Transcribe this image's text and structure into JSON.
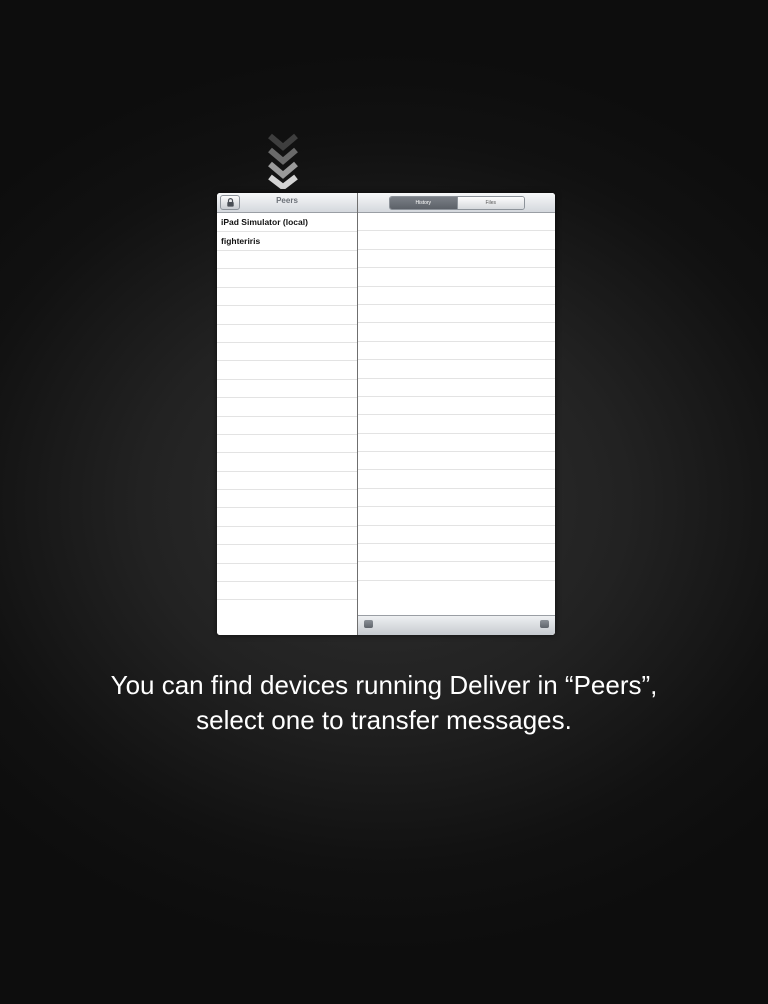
{
  "left_pane": {
    "title": "Peers",
    "lock_icon": "lock-icon",
    "peers": [
      "iPad Simulator (local)",
      "fighteriris"
    ]
  },
  "right_pane": {
    "tabs": [
      {
        "label": "History",
        "selected": true
      },
      {
        "label": "Files",
        "selected": false
      }
    ],
    "toolbar_icons": [
      "list-icon",
      "add-icon"
    ]
  },
  "caption": {
    "line1": "You can find devices running Deliver in “Peers”,",
    "line2": "select one to transfer messages."
  },
  "colors": {
    "background": "#1c1c1c",
    "caption_text": "#ffffff",
    "segment_active": "#666b72"
  }
}
